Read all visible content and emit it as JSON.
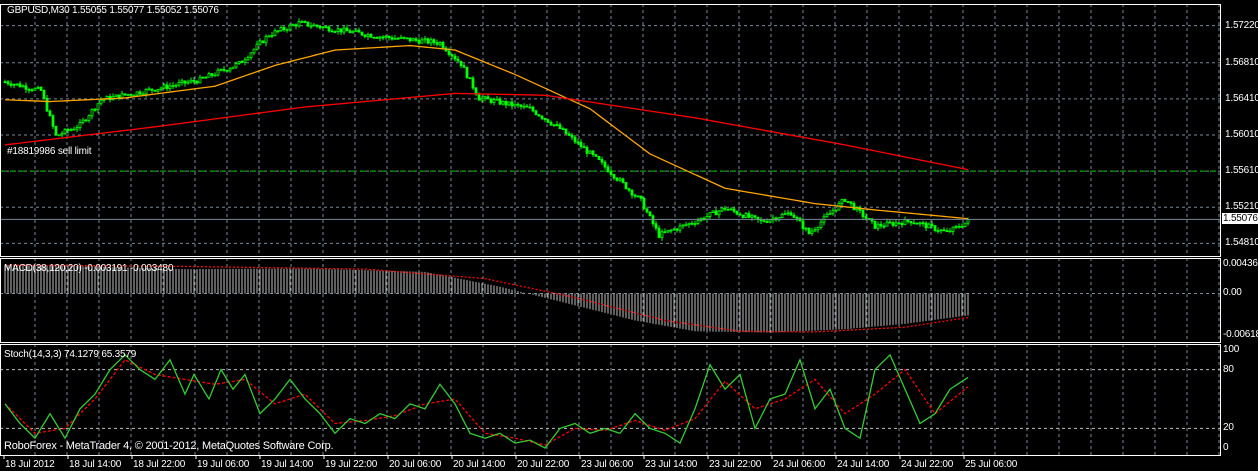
{
  "header": {
    "symbol_info": "GBPUSD,M30  1.55055 1.55077 1.55052 1.55076"
  },
  "order_label": "#18819986 sell limit",
  "footer": "RoboForex - MetaTrader 4, © 2001-2012, MetaQuotes Software Corp.",
  "macd_label": "MACD(38,120,20) -0.003191 -0.003480",
  "stoch_label": "Stoch(14,3,3) 74.1279 65.3579",
  "colors": {
    "bull": "#00ff00",
    "bear": "#00ff00",
    "ma_fast": "#ffa500",
    "ma_slow": "#ff0000",
    "order": "#00c000",
    "grid": "#778899",
    "stoch_main": "#32cd32",
    "stoch_signal": "#ff0000"
  },
  "chart_data": {
    "type": "candlestick",
    "price_axis": {
      "ticks": [
        "1.57220",
        "1.56810",
        "1.56410",
        "1.56010",
        "1.55610",
        "1.55210",
        "1.54810"
      ],
      "current": "1.55076",
      "range": [
        1.5467,
        1.5746
      ]
    },
    "time_axis": [
      "18 Jul 2012",
      "18 Jul 14:00",
      "18 Jul 22:00",
      "19 Jul 06:00",
      "19 Jul 14:00",
      "19 Jul 22:00",
      "20 Jul 06:00",
      "20 Jul 14:00",
      "20 Jul 22:00",
      "23 Jul 06:00",
      "23 Jul 14:00",
      "23 Jul 22:00",
      "24 Jul 06:00",
      "24 Jul 14:00",
      "24 Jul 22:00",
      "25 Jul 06:00"
    ],
    "bars": 322,
    "close_keyframes": [
      [
        0,
        1.566
      ],
      [
        12,
        1.565
      ],
      [
        17,
        1.56
      ],
      [
        25,
        1.5612
      ],
      [
        32,
        1.564
      ],
      [
        50,
        1.5652
      ],
      [
        65,
        1.5662
      ],
      [
        78,
        1.568
      ],
      [
        88,
        1.5712
      ],
      [
        98,
        1.5725
      ],
      [
        110,
        1.5718
      ],
      [
        125,
        1.571
      ],
      [
        145,
        1.5703
      ],
      [
        152,
        1.568
      ],
      [
        158,
        1.5642
      ],
      [
        175,
        1.563
      ],
      [
        185,
        1.5608
      ],
      [
        198,
        1.5572
      ],
      [
        212,
        1.5528
      ],
      [
        218,
        1.549
      ],
      [
        232,
        1.5508
      ],
      [
        240,
        1.552
      ],
      [
        252,
        1.5505
      ],
      [
        262,
        1.5515
      ],
      [
        268,
        1.5492
      ],
      [
        280,
        1.553
      ],
      [
        290,
        1.55
      ],
      [
        302,
        1.5506
      ],
      [
        314,
        1.5493
      ],
      [
        322,
        1.5507
      ]
    ],
    "ma_fast_keyframes": [
      [
        0,
        1.564
      ],
      [
        15,
        1.5638
      ],
      [
        40,
        1.5642
      ],
      [
        70,
        1.5655
      ],
      [
        90,
        1.5678
      ],
      [
        110,
        1.5695
      ],
      [
        135,
        1.57
      ],
      [
        150,
        1.5695
      ],
      [
        170,
        1.5668
      ],
      [
        195,
        1.563
      ],
      [
        215,
        1.558
      ],
      [
        240,
        1.5542
      ],
      [
        270,
        1.5525
      ],
      [
        290,
        1.5518
      ],
      [
        322,
        1.5508
      ]
    ],
    "ma_slow_keyframes": [
      [
        0,
        1.559
      ],
      [
        50,
        1.561
      ],
      [
        100,
        1.5632
      ],
      [
        150,
        1.5647
      ],
      [
        180,
        1.5645
      ],
      [
        230,
        1.562
      ],
      [
        280,
        1.559
      ],
      [
        322,
        1.5562
      ]
    ],
    "order_level": 1.5561,
    "macd": {
      "ticks": [
        "0.00436",
        "0.00",
        "-0.00618"
      ],
      "range": [
        -0.0063,
        0.00436
      ],
      "hist_keyframes": [
        [
          0,
          0.0042
        ],
        [
          20,
          0.0041
        ],
        [
          60,
          0.0036
        ],
        [
          100,
          0.0037
        ],
        [
          140,
          0.0032
        ],
        [
          165,
          0.001
        ],
        [
          185,
          -0.0012
        ],
        [
          210,
          -0.004
        ],
        [
          230,
          -0.0056
        ],
        [
          255,
          -0.0058
        ],
        [
          280,
          -0.0053
        ],
        [
          300,
          -0.0045
        ],
        [
          322,
          -0.0032
        ]
      ],
      "signal_keyframes": [
        [
          0,
          0.0042
        ],
        [
          60,
          0.004
        ],
        [
          120,
          0.0036
        ],
        [
          160,
          0.0022
        ],
        [
          190,
          -0.0006
        ],
        [
          220,
          -0.004
        ],
        [
          245,
          -0.0056
        ],
        [
          270,
          -0.0057
        ],
        [
          300,
          -0.005
        ],
        [
          322,
          -0.0035
        ]
      ]
    },
    "stoch": {
      "ticks": [
        "100",
        "80",
        "20",
        "0"
      ],
      "range": [
        0,
        100
      ],
      "main_keyframes": [
        [
          0,
          45
        ],
        [
          5,
          25
        ],
        [
          10,
          10
        ],
        [
          15,
          35
        ],
        [
          20,
          10
        ],
        [
          25,
          40
        ],
        [
          30,
          55
        ],
        [
          35,
          80
        ],
        [
          40,
          95
        ],
        [
          45,
          80
        ],
        [
          50,
          70
        ],
        [
          55,
          90
        ],
        [
          60,
          55
        ],
        [
          63,
          75
        ],
        [
          68,
          50
        ],
        [
          72,
          80
        ],
        [
          76,
          60
        ],
        [
          80,
          75
        ],
        [
          85,
          35
        ],
        [
          90,
          50
        ],
        [
          95,
          70
        ],
        [
          100,
          50
        ],
        [
          105,
          35
        ],
        [
          110,
          15
        ],
        [
          115,
          30
        ],
        [
          120,
          25
        ],
        [
          125,
          35
        ],
        [
          130,
          30
        ],
        [
          135,
          45
        ],
        [
          140,
          40
        ],
        [
          145,
          65
        ],
        [
          150,
          45
        ],
        [
          155,
          15
        ],
        [
          160,
          10
        ],
        [
          165,
          15
        ],
        [
          170,
          5
        ],
        [
          175,
          8
        ],
        [
          180,
          0
        ],
        [
          185,
          20
        ],
        [
          190,
          25
        ],
        [
          195,
          15
        ],
        [
          200,
          20
        ],
        [
          205,
          15
        ],
        [
          210,
          35
        ],
        [
          215,
          20
        ],
        [
          220,
          15
        ],
        [
          225,
          5
        ],
        [
          230,
          40
        ],
        [
          235,
          85
        ],
        [
          240,
          60
        ],
        [
          245,
          75
        ],
        [
          250,
          20
        ],
        [
          255,
          50
        ],
        [
          260,
          55
        ],
        [
          265,
          90
        ],
        [
          270,
          40
        ],
        [
          275,
          60
        ],
        [
          280,
          20
        ],
        [
          285,
          10
        ],
        [
          290,
          80
        ],
        [
          295,
          95
        ],
        [
          300,
          60
        ],
        [
          305,
          25
        ],
        [
          310,
          35
        ],
        [
          315,
          60
        ],
        [
          322,
          74
        ]
      ],
      "signal_keyframes": [
        [
          0,
          45
        ],
        [
          10,
          15
        ],
        [
          20,
          20
        ],
        [
          30,
          50
        ],
        [
          40,
          90
        ],
        [
          50,
          75
        ],
        [
          60,
          70
        ],
        [
          70,
          65
        ],
        [
          80,
          70
        ],
        [
          90,
          45
        ],
        [
          100,
          55
        ],
        [
          110,
          25
        ],
        [
          120,
          28
        ],
        [
          130,
          33
        ],
        [
          140,
          45
        ],
        [
          150,
          50
        ],
        [
          160,
          15
        ],
        [
          170,
          10
        ],
        [
          180,
          3
        ],
        [
          190,
          20
        ],
        [
          200,
          18
        ],
        [
          210,
          28
        ],
        [
          220,
          18
        ],
        [
          230,
          30
        ],
        [
          240,
          68
        ],
        [
          250,
          40
        ],
        [
          260,
          50
        ],
        [
          270,
          70
        ],
        [
          280,
          35
        ],
        [
          290,
          55
        ],
        [
          300,
          80
        ],
        [
          310,
          35
        ],
        [
          322,
          65
        ]
      ]
    }
  }
}
